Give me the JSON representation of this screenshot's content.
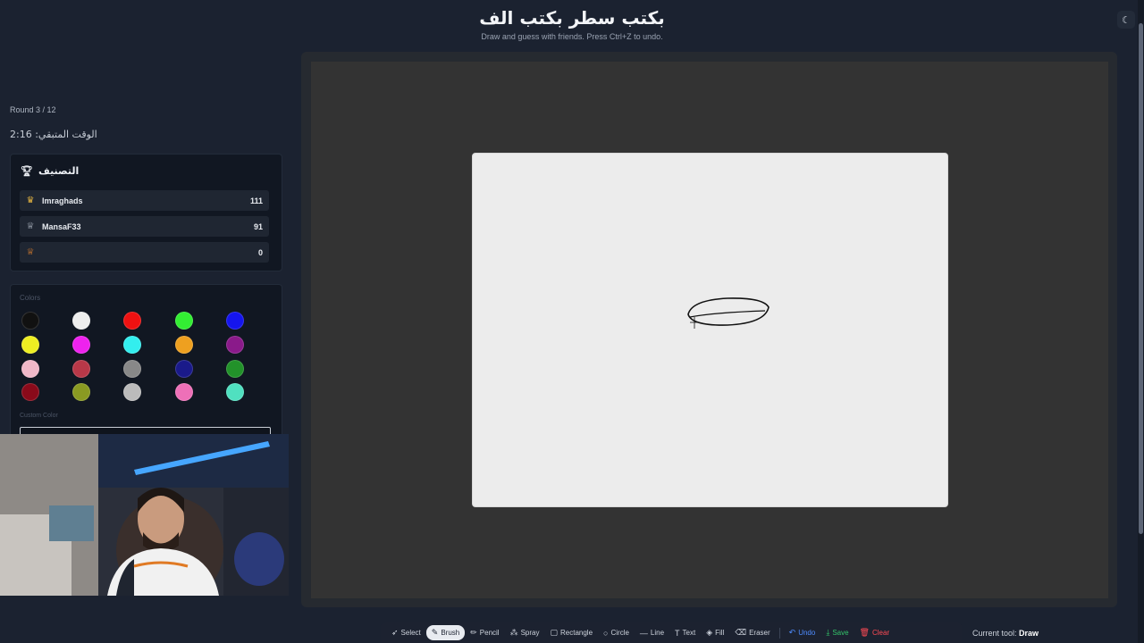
{
  "header": {
    "title": "بكتب سطر بكتب الف",
    "subtitle": "Draw and guess with friends. Press Ctrl+Z to undo.",
    "theme_icon": "moon-icon"
  },
  "game": {
    "round": "Round 3 / 12",
    "time_left": "الوقت المتبقي: 2:16"
  },
  "leaderboard": {
    "title": "التصنيف",
    "icon": "trophy-icon",
    "players": [
      {
        "name": "Imraghads",
        "score": "111",
        "icon": "crown-icon",
        "icon_color": "#e3b341"
      },
      {
        "name": "MansaF33",
        "score": "91",
        "icon": "trophy-icon",
        "icon_color": "#b9c0cb"
      },
      {
        "name": "",
        "score": "0",
        "icon": "trophy-icon",
        "icon_color": "#e8852d"
      }
    ]
  },
  "palette": {
    "label": "Colors",
    "custom_label": "Custom Color",
    "colors": [
      "#111111",
      "#eeeeee",
      "#ee1111",
      "#33ee33",
      "#1515ee",
      "#eeee22",
      "#ee22ee",
      "#33eeee",
      "#eea020",
      "#8a1a8a",
      "#f0b8c8",
      "#b83848",
      "#888888",
      "#1a1a8a",
      "#22922a",
      "#8a0a1a",
      "#8a9a22",
      "#bbbbbb",
      "#ee70b8",
      "#50e0c0"
    ]
  },
  "toolbar": {
    "tools": [
      {
        "label": "Select",
        "icon": "cursor-icon",
        "glyph": "➶"
      },
      {
        "label": "Brush",
        "icon": "brush-icon",
        "glyph": "✎",
        "active": true
      },
      {
        "label": "Pencil",
        "icon": "pencil-icon",
        "glyph": "✏"
      },
      {
        "label": "Spray",
        "icon": "spray-icon",
        "glyph": "⁂"
      },
      {
        "label": "Rectangle",
        "icon": "rectangle-icon",
        "glyph": "▢"
      },
      {
        "label": "Circle",
        "icon": "circle-icon",
        "glyph": "○"
      },
      {
        "label": "Line",
        "icon": "line-icon",
        "glyph": "—"
      },
      {
        "label": "Text",
        "icon": "text-icon",
        "glyph": "T"
      },
      {
        "label": "Fill",
        "icon": "fill-icon",
        "glyph": "◈"
      },
      {
        "label": "Eraser",
        "icon": "eraser-icon",
        "glyph": "⌫"
      }
    ],
    "undo": "Undo",
    "save": "Save",
    "clear": "Clear",
    "current_tool_label": "Current tool:",
    "current_tool": "Draw"
  },
  "colors": {
    "background": "#1b2230",
    "canvas": "#ececec",
    "accent_blue": "#4e8cff",
    "accent_green": "#34c46a",
    "accent_red": "#ff4b55"
  }
}
